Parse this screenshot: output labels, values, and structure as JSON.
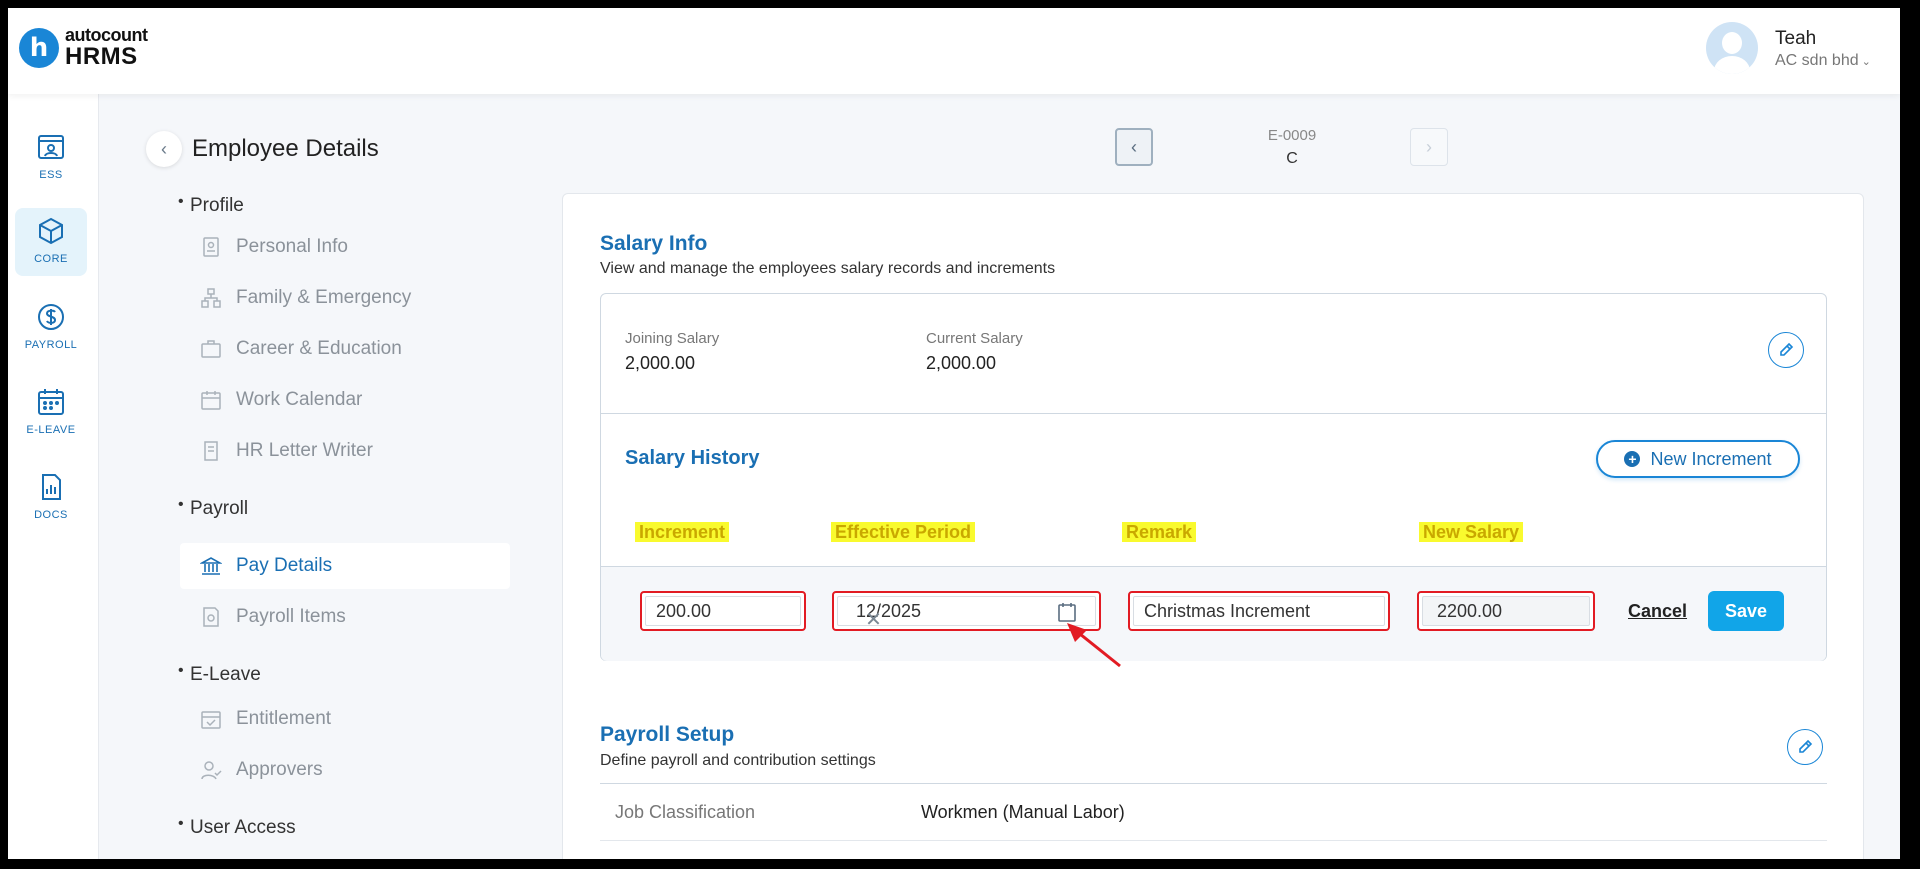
{
  "header": {
    "logo_small": "autocount",
    "logo_big": "HRMS",
    "logo_letter": "h",
    "user_name": "Teah",
    "company": "AC sdn bhd"
  },
  "rail": [
    {
      "label": "ESS",
      "icon": "ess-icon",
      "active": false
    },
    {
      "label": "CORE",
      "icon": "core-icon",
      "active": true
    },
    {
      "label": "PAYROLL",
      "icon": "payroll-icon",
      "active": false
    },
    {
      "label": "E-LEAVE",
      "icon": "calendar-icon",
      "active": false
    },
    {
      "label": "DOCS",
      "icon": "docs-icon",
      "active": false
    }
  ],
  "page": {
    "title": "Employee Details",
    "employee_code": "E-0009",
    "employee_name": "C"
  },
  "subnav": {
    "profile": "Profile",
    "personal_info": "Personal Info",
    "family": "Family & Emergency",
    "career": "Career & Education",
    "work_calendar": "Work Calendar",
    "hr_letter": "HR Letter Writer",
    "payroll": "Payroll",
    "pay_details": "Pay Details",
    "payroll_items": "Payroll Items",
    "eleave": "E-Leave",
    "entitlement": "Entitlement",
    "approvers": "Approvers",
    "user_access": "User Access"
  },
  "salary_info": {
    "title": "Salary Info",
    "subtitle": "View and manage the employees salary records and increments",
    "joining_label": "Joining Salary",
    "joining_value": "2,000.00",
    "current_label": "Current Salary",
    "current_value": "2,000.00"
  },
  "salary_history": {
    "title": "Salary History",
    "new_increment": "New Increment",
    "columns": [
      "Increment",
      "Effective Period",
      "Remark",
      "New Salary"
    ],
    "row": {
      "increment": "200.00",
      "effective_period": "12/2025",
      "remark": "Christmas Increment",
      "new_salary": "2200.00"
    },
    "cancel": "Cancel",
    "save": "Save"
  },
  "payroll_setup": {
    "title": "Payroll Setup",
    "subtitle": "Define payroll and contribution settings",
    "job_label": "Job Classification",
    "job_value": "Workmen (Manual Labor)"
  },
  "colors": {
    "accent": "#1a6fb3",
    "save": "#11a5e8",
    "highlight": "#f9fa2e",
    "annotation": "#e21b23"
  }
}
